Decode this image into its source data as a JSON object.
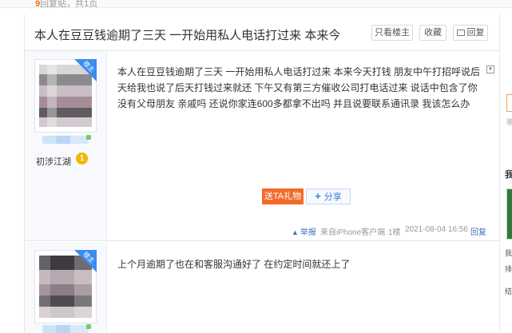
{
  "header_strip": {
    "count": "9",
    "text": "回复贴，共1页"
  },
  "thread": {
    "title": "本人在豆豆钱逾期了三天 一开始用私人电话打过来 本来今",
    "buttons": {
      "only_op": "只看楼主",
      "favorite": "收藏",
      "reply": "回复"
    }
  },
  "posts": [
    {
      "badge": "楼主",
      "level_name": "初涉江湖",
      "level_num": "1",
      "content": "本人在豆豆钱逾期了三天 一开始用私人电话打过来 本来今天打钱 朋友中午打招呼说后天给我也说了后天打钱过来就还 下午又有第三方催收公司打电话过来 说话中包含了你没有父母朋友 亲戚吗 还说你家连600多都拿不出吗 并且说要联系通讯录 我该怎么办",
      "gift_label": "送TA礼物",
      "share_label": "分享",
      "report_label": "举报",
      "client": "来自iPhone客户端",
      "floor": "1楼",
      "time": "2021-08-04 16:56",
      "reply_label": "回复"
    },
    {
      "badge": "楼主",
      "content": "上个月逾期了也在和客服沟通好了 在约定时间就还上了"
    }
  ],
  "right_panel": {
    "t1": "赠",
    "t2": "我",
    "t3": "我",
    "t4": "排",
    "t5": "结"
  }
}
